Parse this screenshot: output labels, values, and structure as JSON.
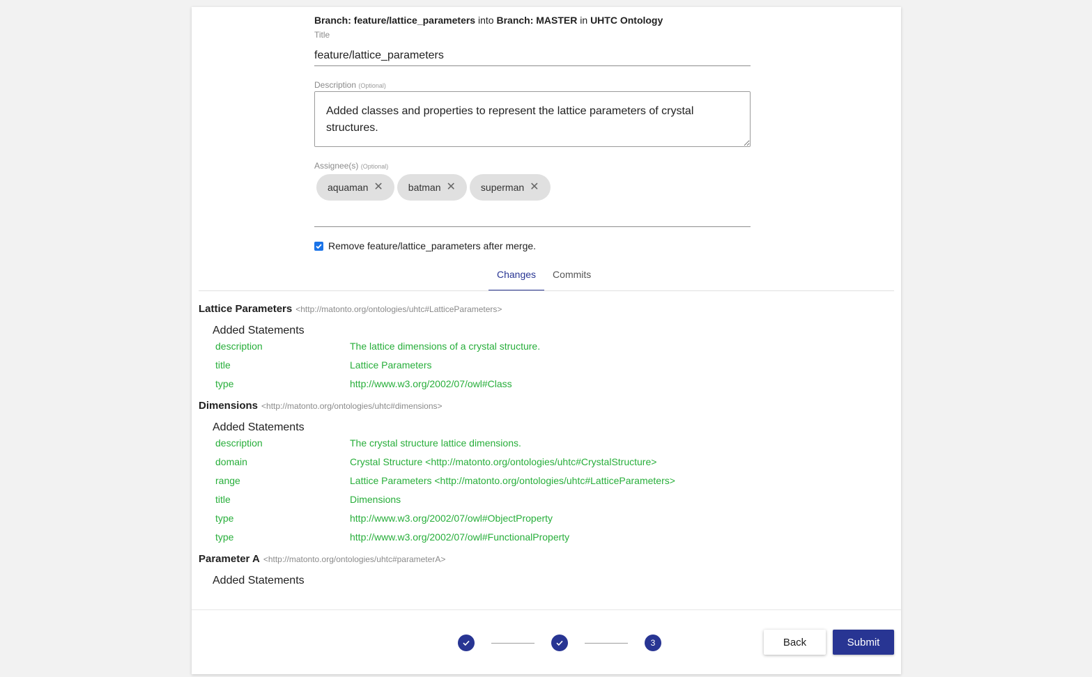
{
  "header": {
    "source_prefix": "Branch: feature/lattice_parameters",
    "into_word": "into",
    "target": "Branch: MASTER",
    "in_word": "in",
    "record": "UHTC Ontology"
  },
  "form": {
    "title_label": "Title",
    "title_value": "feature/lattice_parameters",
    "description_label": "Description",
    "optional_text": "(Optional)",
    "description_value": "Added classes and properties to represent the lattice parameters of crystal structures.",
    "assignees_label": "Assignee(s)",
    "assignees": [
      "aquaman",
      "batman",
      "superman"
    ],
    "remove_checkbox_label": "Remove feature/lattice_parameters after merge.",
    "remove_checked": true
  },
  "tabs": [
    {
      "label": "Changes",
      "active": true
    },
    {
      "label": "Commits",
      "active": false
    }
  ],
  "changes": [
    {
      "title": "Lattice Parameters",
      "iri": "<http://matonto.org/ontologies/uhtc#LatticeParameters>",
      "section": "Added Statements",
      "statements": [
        {
          "predicate": "description",
          "object": "The lattice dimensions of a crystal structure."
        },
        {
          "predicate": "title",
          "object": "Lattice Parameters"
        },
        {
          "predicate": "type",
          "object": "http://www.w3.org/2002/07/owl#Class"
        }
      ]
    },
    {
      "title": "Dimensions",
      "iri": "<http://matonto.org/ontologies/uhtc#dimensions>",
      "section": "Added Statements",
      "statements": [
        {
          "predicate": "description",
          "object": "The crystal structure lattice dimensions."
        },
        {
          "predicate": "domain",
          "object": "Crystal Structure <http://matonto.org/ontologies/uhtc#CrystalStructure>"
        },
        {
          "predicate": "range",
          "object": "Lattice Parameters <http://matonto.org/ontologies/uhtc#LatticeParameters>"
        },
        {
          "predicate": "title",
          "object": "Dimensions"
        },
        {
          "predicate": "type",
          "object": "http://www.w3.org/2002/07/owl#ObjectProperty"
        },
        {
          "predicate": "type",
          "object": "http://www.w3.org/2002/07/owl#FunctionalProperty"
        }
      ]
    },
    {
      "title": "Parameter A",
      "iri": "<http://matonto.org/ontologies/uhtc#parameterA>",
      "section": "Added Statements",
      "statements": []
    }
  ],
  "stepper": {
    "steps": [
      {
        "state": "done",
        "icon": "check-icon"
      },
      {
        "state": "done",
        "icon": "check-icon"
      },
      {
        "state": "current",
        "label": "3"
      }
    ]
  },
  "actions": {
    "back_label": "Back",
    "submit_label": "Submit"
  },
  "colors": {
    "primary": "#283593",
    "added": "#27ae3a",
    "checkbox": "#1a73e8"
  }
}
